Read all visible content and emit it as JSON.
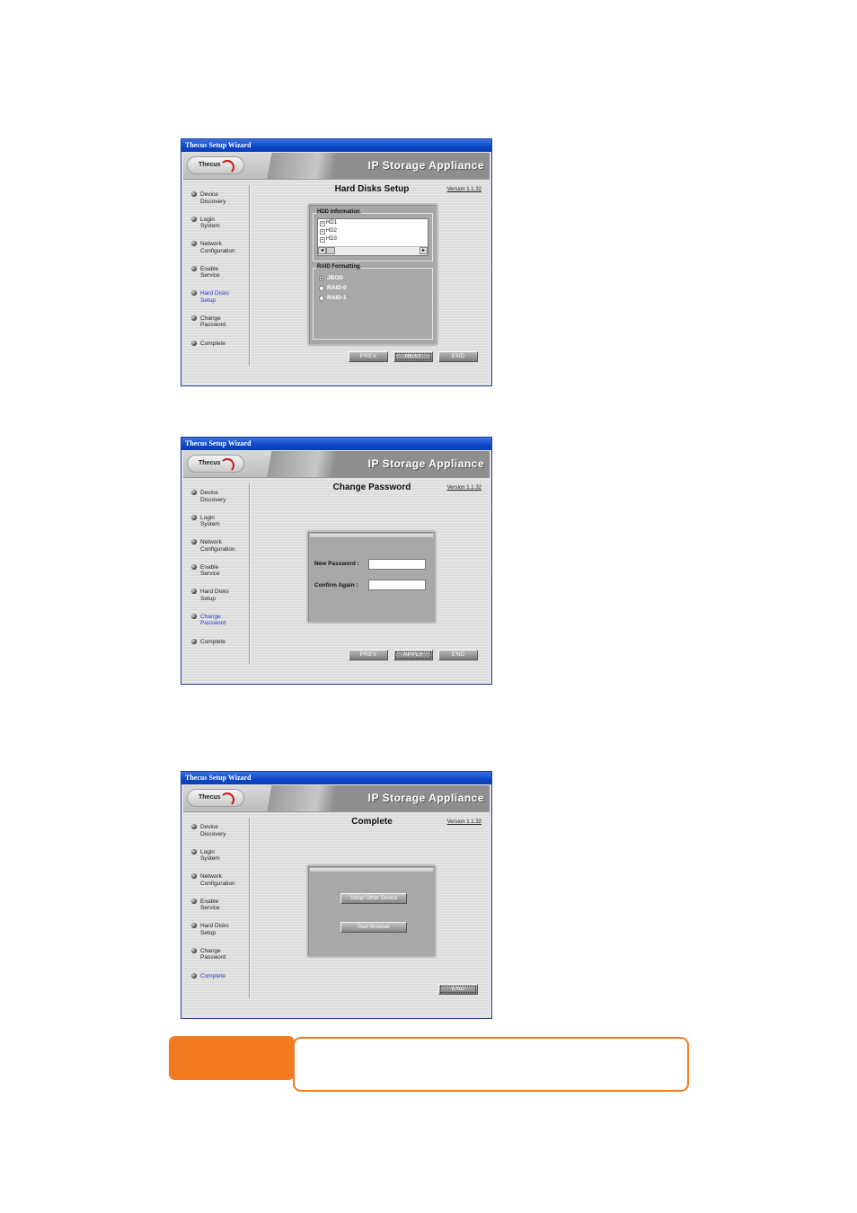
{
  "common": {
    "window_title": "Thecus Setup Wizard",
    "logo_text": "Thecus",
    "banner_title": "IP Storage Appliance",
    "version": "Version 1.1.32",
    "sidebar": [
      {
        "line1": "Device",
        "line2": "Discovery"
      },
      {
        "line1": "Login",
        "line2": "System"
      },
      {
        "line1": "Network",
        "line2": "Configuration"
      },
      {
        "line1": "Enable",
        "line2": "Service"
      },
      {
        "line1": "Hard Disks",
        "line2": "Setup"
      },
      {
        "line1": "Change",
        "line2": "Password"
      },
      {
        "line1": "Complete",
        "line2": ""
      }
    ],
    "buttons": {
      "prev": "PREV",
      "next": "NEXT",
      "apply": "APPLY",
      "end": "END"
    }
  },
  "screens": [
    {
      "title": "Hard Disks Setup",
      "active_step": 4,
      "hdd_legend": "HDD Information",
      "hdds": [
        "HD1",
        "HD2",
        "HD3"
      ],
      "raid_legend": "RAID Formatting",
      "raid_options": [
        "JBOD",
        "RAID-0",
        "RAID-1"
      ],
      "raid_selected": "JBOD"
    },
    {
      "title": "Change Password",
      "active_step": 5,
      "new_password_label": "New Password :",
      "confirm_label": "Confirm Again :",
      "new_password_value": "",
      "confirm_value": ""
    },
    {
      "title": "Complete",
      "active_step": 6,
      "setup_other_label": "Setup Other Device",
      "start_browser_label": "Start Browser"
    }
  ],
  "colors": {
    "titlebar": "#0b46c8",
    "active_step": "#1a3fc8",
    "note_accent": "#f47a20"
  }
}
